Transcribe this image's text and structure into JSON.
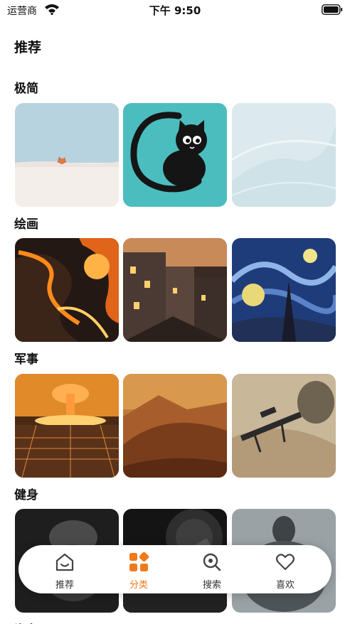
{
  "status_bar": {
    "carrier": "运营商",
    "time": "下午 9:50"
  },
  "page_title": "推荐",
  "sections": [
    {
      "title": "极简"
    },
    {
      "title": "绘画"
    },
    {
      "title": "军事"
    },
    {
      "title": "健身"
    },
    {
      "title": "汽车"
    }
  ],
  "tab_bar": {
    "tabs": [
      {
        "label": "推荐",
        "icon": "home-icon"
      },
      {
        "label": "分类",
        "icon": "category-icon"
      },
      {
        "label": "搜索",
        "icon": "search-icon"
      },
      {
        "label": "喜欢",
        "icon": "heart-icon"
      }
    ],
    "active_index": 1,
    "active_color": "#ef7a1a"
  }
}
